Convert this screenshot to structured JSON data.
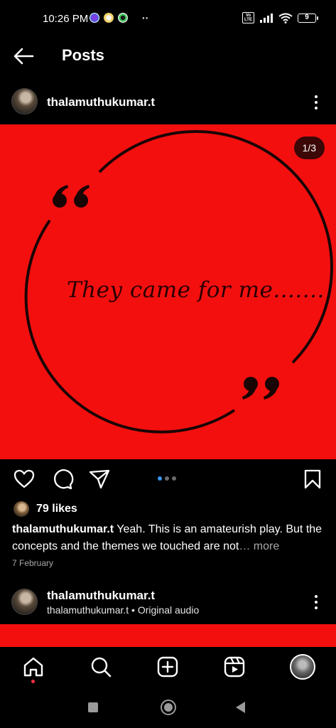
{
  "status_bar": {
    "time": "10:26 PM",
    "more": "··",
    "volte": "Vo LTE",
    "battery": "9",
    "battery_fraction": 0.09
  },
  "header": {
    "title": "Posts",
    "back_icon": "arrow-left-icon"
  },
  "post": {
    "username": "thalamuthukumar.t",
    "menu_icon": "more-vertical-icon",
    "image": {
      "counter": "1/3",
      "quote_text": "They came for me.......",
      "background": "#f40f0f"
    },
    "carousel": {
      "count": 3,
      "active_index": 0
    },
    "actions": [
      "heart-icon",
      "comment-icon",
      "share-icon",
      "bookmark-icon"
    ],
    "likes": "79 likes",
    "caption": {
      "username": "thalamuthukumar.t",
      "text": " Yeah. This is an amateurish play. But the concepts and the themes we touched are not",
      "ellipsis": "… ",
      "more": "more"
    },
    "date": "7 February"
  },
  "next_post": {
    "username": "thalamuthukumar.t",
    "subtitle": "thalamuthukumar.t • Original audio"
  },
  "bottom_nav": [
    "home-icon",
    "search-icon",
    "create-icon",
    "reels-icon",
    "profile-avatar"
  ],
  "colors": {
    "accent_blue": "#3897f0",
    "notification_red": "#ff3040"
  }
}
